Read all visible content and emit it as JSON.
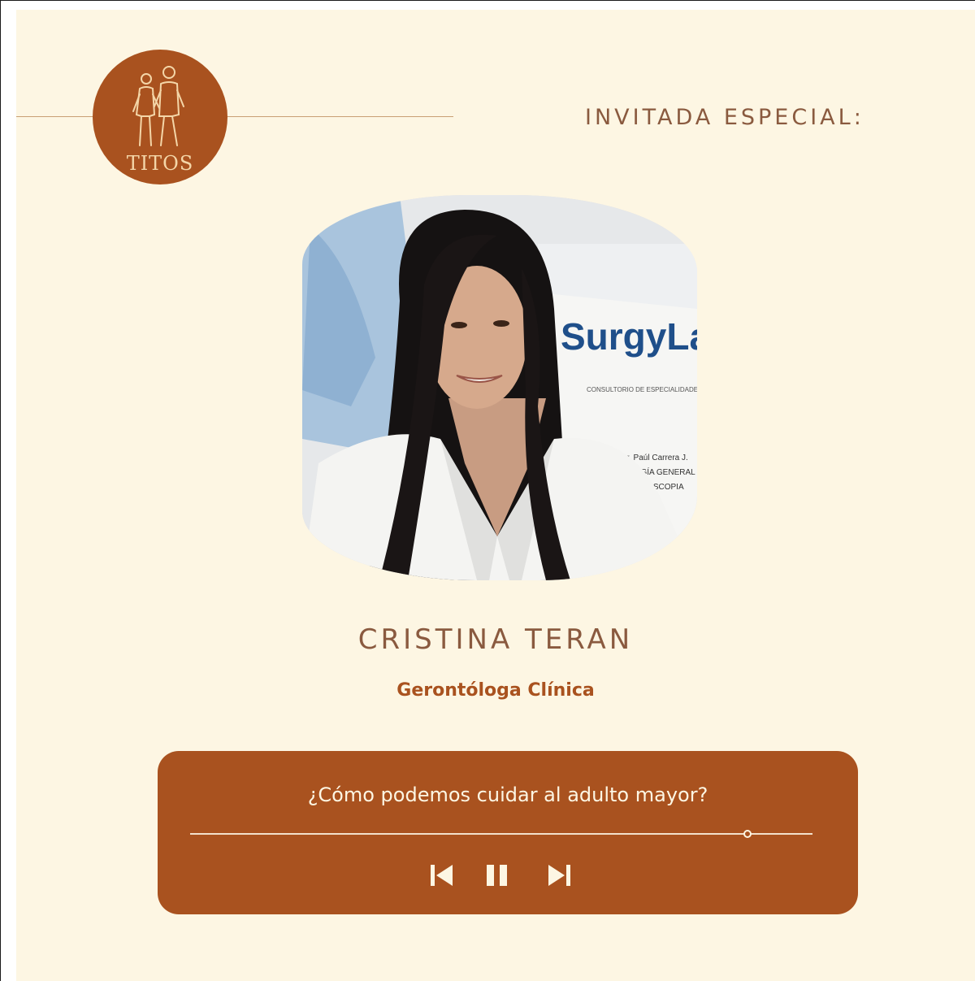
{
  "logo": {
    "text": "TITOS"
  },
  "header": {
    "label": "INVITADA ESPECIAL:"
  },
  "photo": {
    "sign_brand": "SurgyLap",
    "sign_subtitle": "CONSULTORIO DE ESPECIALIDADES",
    "sign_line1": "Dr. Paúl Carrera J.",
    "sign_line2": "CIRUGÍA GENERAL",
    "sign_line3": "LAPAROSCOPIA"
  },
  "guest": {
    "name": "CRISTINA TERAN",
    "role": "Gerontóloga Clínica"
  },
  "player": {
    "title": "¿Cómo podemos cuidar al adulto mayor?",
    "progress": 0.895,
    "controls": [
      "previous",
      "pause",
      "next"
    ]
  },
  "colors": {
    "background": "#fdf6e3",
    "accent": "#a9521f",
    "text_brown": "#8a5a3f"
  }
}
